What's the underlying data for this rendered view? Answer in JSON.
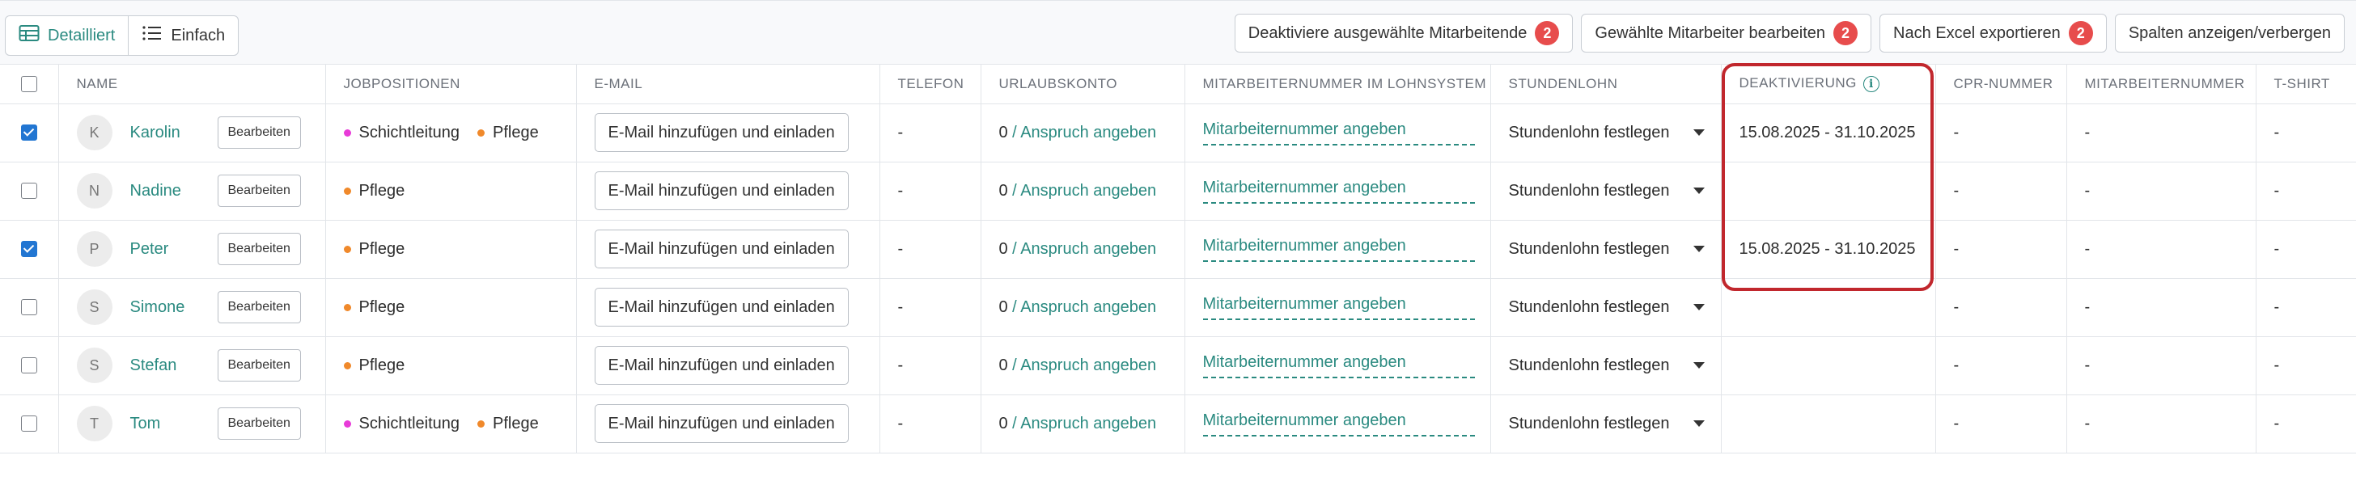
{
  "toolbar": {
    "views": [
      {
        "label": "Detailliert",
        "icon": "table-icon",
        "active": true
      },
      {
        "label": "Einfach",
        "icon": "list-icon",
        "active": false
      }
    ],
    "actions": [
      {
        "label": "Deaktiviere ausgewählte Mitarbeitende",
        "badge": "2"
      },
      {
        "label": "Gewählte Mitarbeiter bearbeiten",
        "badge": "2"
      },
      {
        "label": "Nach Excel exportieren",
        "badge": "2"
      },
      {
        "label": "Spalten anzeigen/verbergen"
      }
    ]
  },
  "table": {
    "columns": [
      "NAME",
      "JOBPOSITIONEN",
      "E-MAIL",
      "TELEFON",
      "URLAUBSKONTO",
      "MITARBEITERNUMMER IM LOHNSYSTEM",
      "STUNDENLOHN",
      "DEAKTIVIERUNG",
      "CPR-NUMMER",
      "MITARBEITERNUMMER",
      "T-SHIRT"
    ],
    "edit_label": "Bearbeiten",
    "email_label": "E-Mail hinzufügen und einladen",
    "vacation_sep": " / ",
    "vacation_link": "Anspruch angeben",
    "employee_number_link": "Mitarbeiternummer angeben",
    "wage_label": "Stundenlohn festlegen",
    "rows": [
      {
        "checked": true,
        "initial": "K",
        "name": "Karolin",
        "jobs": [
          {
            "label": "Schichtleitung",
            "color": "pink"
          },
          {
            "label": "Pflege",
            "color": "orange"
          }
        ],
        "phone": "-",
        "vacation": "0",
        "deactivation": "15.08.2025 - 31.10.2025",
        "cpr": "-",
        "emp_no": "-",
        "tshirt": "-"
      },
      {
        "checked": false,
        "initial": "N",
        "name": "Nadine",
        "jobs": [
          {
            "label": "Pflege",
            "color": "orange"
          }
        ],
        "phone": "-",
        "vacation": "0",
        "deactivation": "",
        "cpr": "-",
        "emp_no": "-",
        "tshirt": "-"
      },
      {
        "checked": true,
        "initial": "P",
        "name": "Peter",
        "jobs": [
          {
            "label": "Pflege",
            "color": "orange"
          }
        ],
        "phone": "-",
        "vacation": "0",
        "deactivation": "15.08.2025 - 31.10.2025",
        "cpr": "-",
        "emp_no": "-",
        "tshirt": "-"
      },
      {
        "checked": false,
        "initial": "S",
        "name": "Simone",
        "jobs": [
          {
            "label": "Pflege",
            "color": "orange"
          }
        ],
        "phone": "-",
        "vacation": "0",
        "deactivation": "",
        "cpr": "-",
        "emp_no": "-",
        "tshirt": "-"
      },
      {
        "checked": false,
        "initial": "S",
        "name": "Stefan",
        "jobs": [
          {
            "label": "Pflege",
            "color": "orange"
          }
        ],
        "phone": "-",
        "vacation": "0",
        "deactivation": "",
        "cpr": "-",
        "emp_no": "-",
        "tshirt": "-"
      },
      {
        "checked": false,
        "initial": "T",
        "name": "Tom",
        "jobs": [
          {
            "label": "Schichtleitung",
            "color": "pink"
          },
          {
            "label": "Pflege",
            "color": "orange"
          }
        ],
        "phone": "-",
        "vacation": "0",
        "deactivation": "",
        "cpr": "-",
        "emp_no": "-",
        "tshirt": "-"
      }
    ]
  },
  "colors": {
    "accent": "#2a8a80",
    "badge": "#e74c4c",
    "highlight": "#c1272d",
    "checkbox": "#2276d2"
  }
}
